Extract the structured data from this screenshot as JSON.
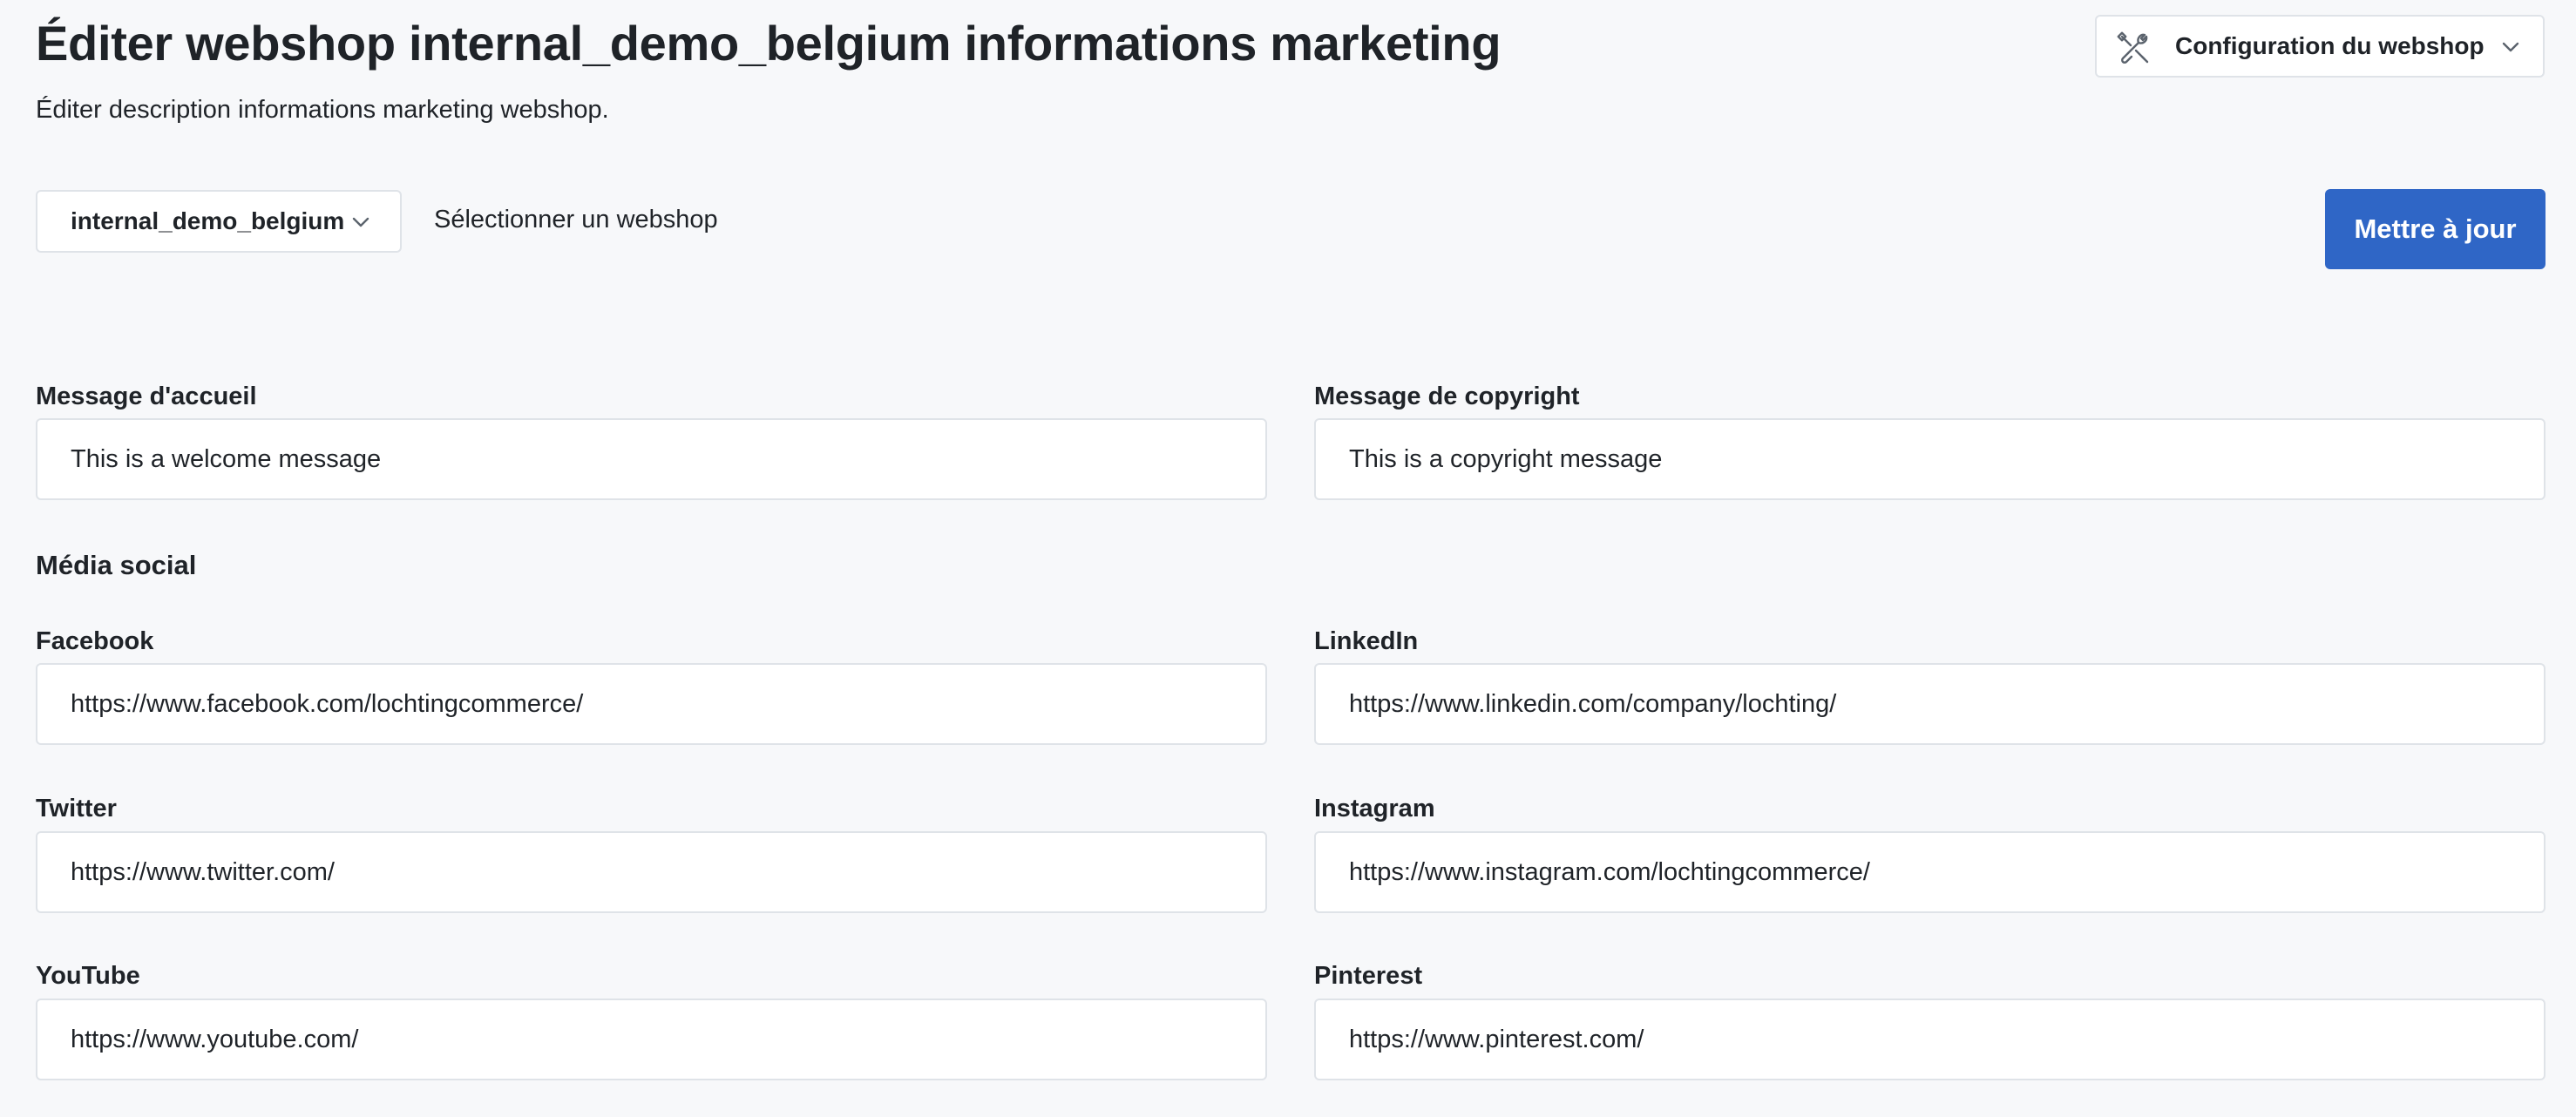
{
  "header": {
    "title": "Éditer webshop internal_demo_belgium informations marketing",
    "subtitle": "Éditer description informations marketing webshop.",
    "config_dropdown": {
      "label": "Configuration du webshop",
      "icon": "tools-icon"
    }
  },
  "toolbar": {
    "webshop_select_value": "internal_demo_belgium",
    "webshop_select_hint": "Sélectionner un webshop",
    "update_label": "Mettre à jour"
  },
  "form": {
    "welcome": {
      "label": "Message d'accueil",
      "value": "This is a welcome message"
    },
    "copyright": {
      "label": "Message de copyright",
      "value": "This is a copyright message"
    },
    "social_section_title": "Média social",
    "facebook": {
      "label": "Facebook",
      "value": "https://www.facebook.com/lochtingcommerce/"
    },
    "linkedin": {
      "label": "LinkedIn",
      "value": "https://www.linkedin.com/company/lochting/"
    },
    "twitter": {
      "label": "Twitter",
      "value": "https://www.twitter.com/"
    },
    "instagram": {
      "label": "Instagram",
      "value": "https://www.instagram.com/lochtingcommerce/"
    },
    "youtube": {
      "label": "YouTube",
      "value": "https://www.youtube.com/"
    },
    "pinterest": {
      "label": "Pinterest",
      "value": "https://www.pinterest.com/"
    }
  },
  "colors": {
    "accent": "#2f66c6",
    "background": "#f7f8fa",
    "border": "#dfe3e8",
    "text": "#1f2328"
  }
}
